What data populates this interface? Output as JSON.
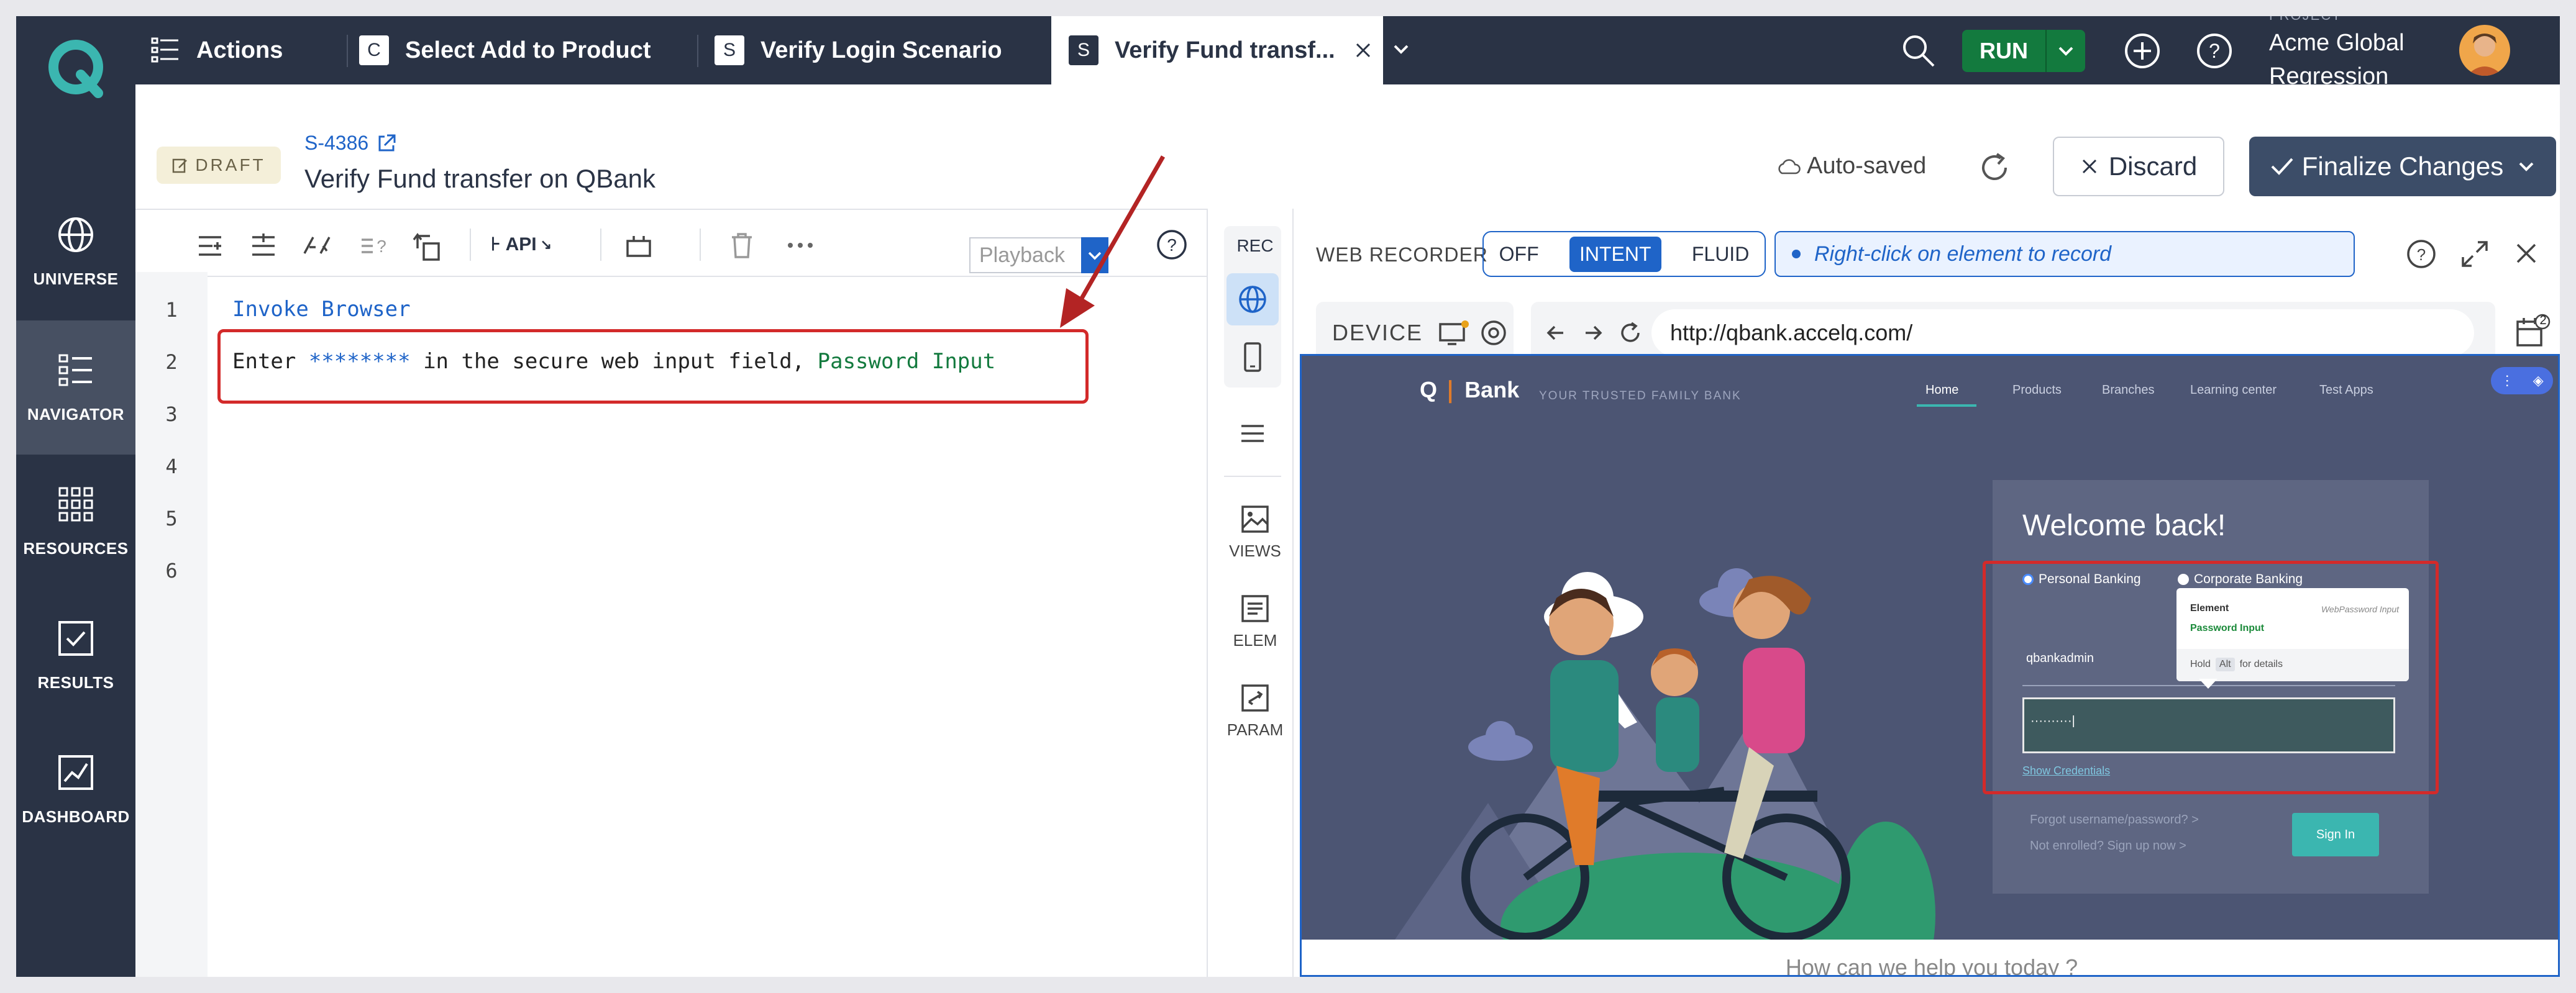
{
  "rail": {
    "items": [
      {
        "label": "UNIVERSE"
      },
      {
        "label": "NAVIGATOR"
      },
      {
        "label": "RESOURCES"
      },
      {
        "label": "RESULTS"
      },
      {
        "label": "DASHBOARD"
      }
    ]
  },
  "tabs": [
    {
      "icon": "",
      "label": "Actions"
    },
    {
      "icon": "C",
      "label": "Select Add to Product"
    },
    {
      "icon": "S",
      "label": "Verify Login Scenario"
    },
    {
      "icon": "S",
      "label": "Verify Fund transf..."
    }
  ],
  "topbar": {
    "run_label": "RUN",
    "project_label": "PROJECT",
    "project_name_line1": "Acme Global",
    "project_name_line2": "Regression"
  },
  "header": {
    "badge": "DRAFT",
    "id": "S-4386",
    "title": "Verify Fund transfer on QBank",
    "autosaved": "Auto-saved",
    "discard": "Discard",
    "finalize": "Finalize Changes"
  },
  "editor": {
    "toolbar": {
      "api_label": "API",
      "playback": "Playback"
    },
    "lines": [
      "1",
      "2",
      "3",
      "4",
      "5",
      "6"
    ],
    "line1": "Invoke Browser",
    "line2_prefix": "Enter ",
    "line2_secret": "********",
    "line2_mid": " in the secure web input field, ",
    "line2_element": "Password Input"
  },
  "strip": {
    "rec": "REC",
    "views": "VIEWS",
    "elem": "ELEM",
    "param": "PARAM"
  },
  "recorder": {
    "label": "WEB RECORDER",
    "modes": [
      "OFF",
      "INTENT",
      "FLUID"
    ],
    "active_mode": "INTENT",
    "hint": "Right-click on element to record",
    "device": "DEVICE",
    "url": "http://qbank.accelq.com/",
    "badge_count": "2"
  },
  "site": {
    "brand": "Bank",
    "brand_mark": "Q",
    "tagline": "YOUR TRUSTED FAMILY BANK",
    "nav": [
      "Home",
      "Products",
      "Branches",
      "Learning center",
      "Test Apps"
    ],
    "welcome": "Welcome back!",
    "radio_personal": "Personal Banking",
    "radio_corporate": "Corporate Banking",
    "username": "qbankadmin",
    "password_mask": "··········|",
    "show_credentials": "Show Credentials",
    "forgot": "Forgot username/password?  >",
    "enroll": "Not enrolled? Sign up now  >",
    "signin": "Sign In",
    "tooltip": {
      "element_label": "Element",
      "element_type": "WebPassword Input",
      "element_name": "Password Input",
      "hold": "Hold",
      "alt": "Alt",
      "details": "for details"
    },
    "bottom": "How can we help you today ?"
  },
  "colors": {
    "dark": "#2a3345",
    "accent": "#1f64c8",
    "run": "#137a3e",
    "highlight": "#d32a2a",
    "teal": "#3bb6b0"
  }
}
